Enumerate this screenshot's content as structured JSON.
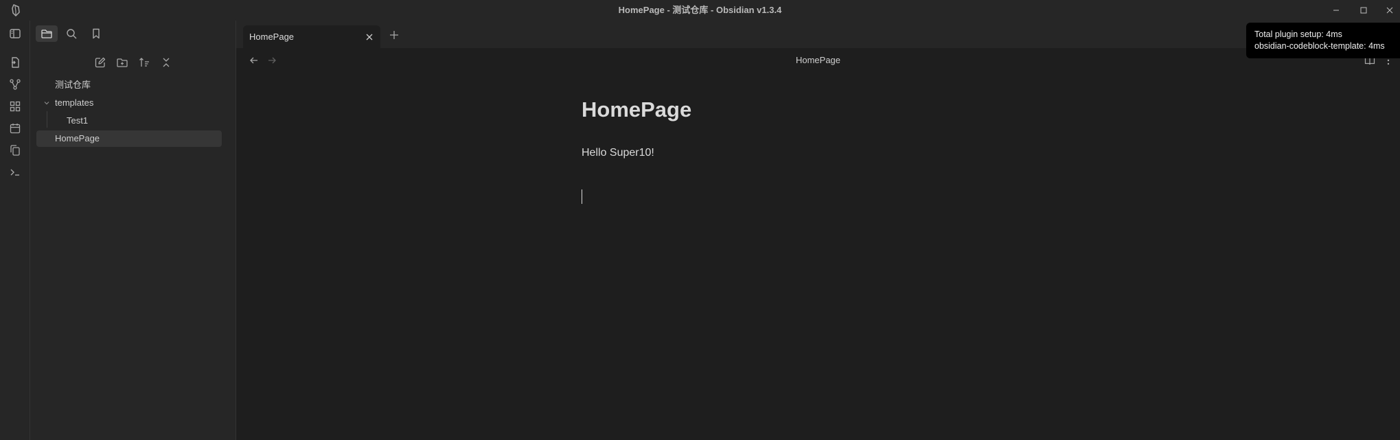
{
  "window": {
    "title": "HomePage - 测试仓库 - Obsidian v1.3.4"
  },
  "sidebar": {
    "tabs": [
      "files-tab",
      "search-tab",
      "bookmarks-tab"
    ],
    "active_tab": "files-tab",
    "file_tree": {
      "vault_name": "测试仓库",
      "folders": [
        {
          "label": "templates",
          "expanded": true,
          "children": [
            "Test1"
          ]
        }
      ],
      "files": [
        {
          "label": "HomePage",
          "active": true
        }
      ]
    }
  },
  "tabs": [
    {
      "label": "HomePage",
      "active": true
    }
  ],
  "view_header": {
    "title": "HomePage"
  },
  "note": {
    "title": "HomePage",
    "body": "Hello Super10!"
  },
  "notice": {
    "line1": "Total plugin setup: 4ms",
    "line2": "obsidian-codeblock-template: 4ms"
  },
  "colors": {
    "background": "#1e1e1e",
    "chrome": "#262626",
    "text": "#dadada",
    "icon": "#a8a8a8"
  }
}
